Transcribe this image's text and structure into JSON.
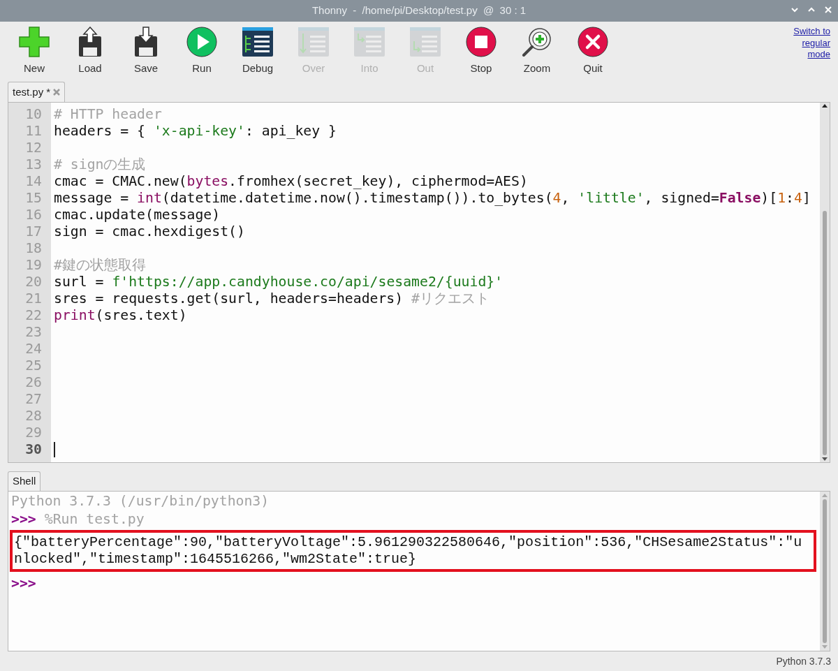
{
  "window": {
    "title": "Thonny  -  /home/pi/Desktop/test.py  @  30 : 1"
  },
  "toolbar": {
    "buttons": [
      {
        "label": "New",
        "disabled": false
      },
      {
        "label": "Load",
        "disabled": false
      },
      {
        "label": "Save",
        "disabled": false
      },
      {
        "label": "Run",
        "disabled": false
      },
      {
        "label": "Debug",
        "disabled": false
      },
      {
        "label": "Over",
        "disabled": true
      },
      {
        "label": "Into",
        "disabled": true
      },
      {
        "label": "Out",
        "disabled": true
      },
      {
        "label": "Stop",
        "disabled": false
      },
      {
        "label": "Zoom",
        "disabled": false
      },
      {
        "label": "Quit",
        "disabled": false
      }
    ],
    "mode_link": "Switch to regular mode"
  },
  "editor": {
    "tabs": [
      {
        "label": "test.py *",
        "selected": true
      }
    ],
    "lines": [
      {
        "number": "10",
        "current": false,
        "tokens": [
          {
            "kind": "comment",
            "text": "# HTTP header"
          }
        ]
      },
      {
        "number": "11",
        "current": false,
        "tokens": [
          {
            "kind": "plain",
            "text": "headers = { "
          },
          {
            "kind": "string",
            "text": "'x-api-key'"
          },
          {
            "kind": "plain",
            "text": ": api_key }"
          }
        ]
      },
      {
        "number": "12",
        "current": false
      },
      {
        "number": "13",
        "current": false,
        "tokens": [
          {
            "kind": "comment",
            "text": "# signの生成"
          }
        ]
      },
      {
        "number": "14",
        "current": false,
        "tokens": [
          {
            "kind": "plain",
            "text": "cmac = CMAC.new("
          },
          {
            "kind": "builtin",
            "text": "bytes"
          },
          {
            "kind": "plain",
            "text": ".fromhex(secret_key), ciphermod=AES)"
          }
        ]
      },
      {
        "number": "15",
        "current": false,
        "tokens": [
          {
            "kind": "plain",
            "text": "message = "
          },
          {
            "kind": "builtin",
            "text": "int"
          },
          {
            "kind": "plain",
            "text": "(datetime.datetime.now().timestamp()).to_bytes("
          },
          {
            "kind": "number",
            "text": "4"
          },
          {
            "kind": "plain",
            "text": ", "
          },
          {
            "kind": "string",
            "text": "'little'"
          },
          {
            "kind": "plain",
            "text": ", signed="
          },
          {
            "kind": "keyword",
            "text": "False"
          },
          {
            "kind": "plain",
            "text": ")["
          },
          {
            "kind": "number",
            "text": "1"
          },
          {
            "kind": "plain",
            "text": ":"
          },
          {
            "kind": "number",
            "text": "4"
          },
          {
            "kind": "plain",
            "text": "]"
          }
        ]
      },
      {
        "number": "16",
        "current": false,
        "tokens": [
          {
            "kind": "plain",
            "text": "cmac.update(message)"
          }
        ]
      },
      {
        "number": "17",
        "current": false,
        "tokens": [
          {
            "kind": "plain",
            "text": "sign = cmac.hexdigest()"
          }
        ]
      },
      {
        "number": "18",
        "current": false
      },
      {
        "number": "19",
        "current": false,
        "tokens": [
          {
            "kind": "comment",
            "text": "#鍵の状態取得"
          }
        ]
      },
      {
        "number": "20",
        "current": false,
        "tokens": [
          {
            "kind": "plain",
            "text": "surl = "
          },
          {
            "kind": "string",
            "text": "f'https://app.candyhouse.co/api/sesame2/{uuid}'"
          }
        ]
      },
      {
        "number": "21",
        "current": false,
        "tokens": [
          {
            "kind": "plain",
            "text": "sres = requests.get(surl, headers=headers) "
          },
          {
            "kind": "comment",
            "text": "#リクエスト"
          }
        ]
      },
      {
        "number": "22",
        "current": false,
        "tokens": [
          {
            "kind": "builtin",
            "text": "print"
          },
          {
            "kind": "plain",
            "text": "(sres.text)"
          }
        ]
      },
      {
        "number": "23",
        "current": false
      },
      {
        "number": "24",
        "current": false
      },
      {
        "number": "25",
        "current": false
      },
      {
        "number": "26",
        "current": false
      },
      {
        "number": "27",
        "current": false
      },
      {
        "number": "28",
        "current": false
      },
      {
        "number": "29",
        "current": false
      },
      {
        "number": "30",
        "current": true
      }
    ]
  },
  "shell": {
    "tabs": [
      {
        "label": "Shell",
        "selected": true
      }
    ],
    "banner": "Python 3.7.3 (/usr/bin/python3)",
    "entries": [
      {
        "kind": "command",
        "prompt": ">>>",
        "text": "%Run test.py"
      },
      {
        "kind": "output",
        "lines": [
          "{\"batteryPercentage\":90,\"batteryVoltage\":5.961290322580646,\"position\":536,\"CHSesame2Status\":\"u",
          "nlocked\",\"timestamp\":1645516266,\"wm2State\":true}"
        ]
      },
      {
        "kind": "prompt",
        "prompt": ">>>"
      }
    ]
  },
  "status_bar": {
    "interpreter": "Python 3.7.3"
  }
}
